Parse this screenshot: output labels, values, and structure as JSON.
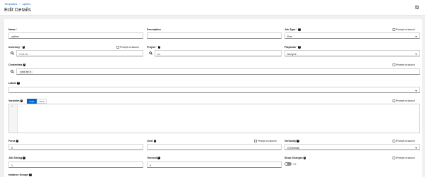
{
  "breadcrumb": {
    "parent": "Templates",
    "separator": "›",
    "current": "uptime"
  },
  "page": {
    "title": "Edit Details"
  },
  "form": {
    "name": {
      "label": "Name",
      "required": "*",
      "value": "uptime"
    },
    "description": {
      "label": "Description",
      "value": ""
    },
    "job_type": {
      "label": "Job Type",
      "required": "*",
      "value": "Run"
    },
    "inventory": {
      "label": "Inventory",
      "required": "*",
      "value": "Host-tst"
    },
    "project": {
      "label": "Project",
      "required": "*",
      "value": "tst"
    },
    "playbook": {
      "label": "Playbook",
      "required": "*",
      "value": "test.yml"
    },
    "credentials": {
      "label": "Credentials",
      "chip": "xxxx: tst"
    },
    "labels": {
      "label": "Labels"
    },
    "variables": {
      "label": "Variables",
      "yaml_label": "YAML",
      "json_label": "JSON",
      "line_no": "1",
      "code": "---"
    },
    "forks": {
      "label": "Forks",
      "value": "0"
    },
    "limit": {
      "label": "Limit",
      "value": ""
    },
    "verbosity": {
      "label": "Verbosity",
      "value": "0 (Normal)"
    },
    "job_slicing": {
      "label": "Job Slicing",
      "value": "1"
    },
    "timeout": {
      "label": "Timeout",
      "value": "0"
    },
    "show_changes": {
      "label": "Show Changes",
      "state": "Off"
    },
    "instance_groups": {
      "label": "Instance Groups"
    }
  },
  "prompt_on_launch": "Prompt on launch",
  "icons": {
    "history": "history-icon",
    "search": "search-icon",
    "help": "help-icon",
    "caret": "caret-down-icon",
    "close": "close-icon"
  },
  "colors": {
    "accent": "#0066cc",
    "required": "#c9190b",
    "background": "#f0f0f0"
  }
}
